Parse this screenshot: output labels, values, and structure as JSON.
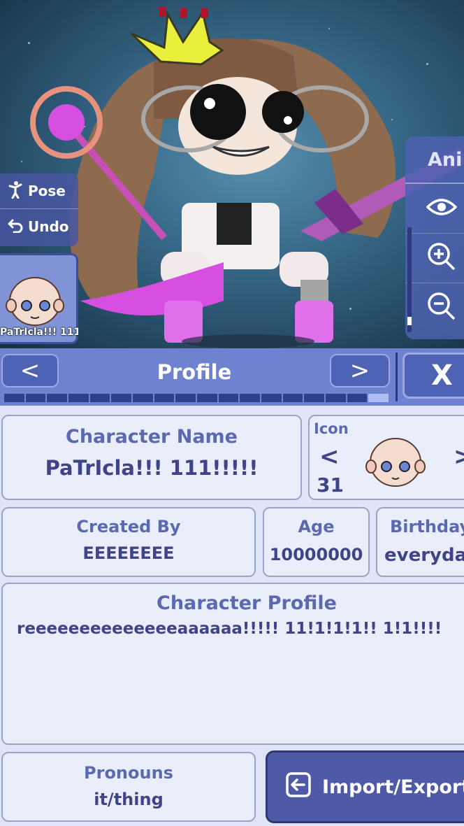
{
  "side_panel": {
    "pose_label": "Pose",
    "undo_label": "Undo"
  },
  "character_slot": {
    "label": "PaTrIcla!!! 111"
  },
  "right_panel": {
    "title": "Ani"
  },
  "header": {
    "title": "Profile",
    "prev": "<",
    "next": ">",
    "close": "X"
  },
  "tab_progress": {
    "filled_fraction": 0.06
  },
  "profile": {
    "name_label": "Character Name",
    "name_value": "PaTrIcla!!! 111!!!!!",
    "icon_label": "Icon",
    "icon_number": "31",
    "icon_prev": "<",
    "icon_next": ">",
    "created_by_label": "Created By",
    "created_by_value": "EEEEEEEE",
    "age_label": "Age",
    "age_value": "10000000",
    "birthday_label": "Birthday",
    "birthday_value": "everyday",
    "profile_label": "Character Profile",
    "profile_value": "reeeeeeeeeeeeeeaaaaaa!!!!! 11!1!1!1!! 1!1!!!!",
    "pronouns_label": "Pronouns",
    "pronouns_value": "it/thing"
  },
  "actions": {
    "import_export_label": "Import/Export"
  },
  "colors": {
    "panel": "#6e82cf",
    "card_bg": "#eaeefa",
    "label": "#5b6ab0",
    "value": "#3f4488",
    "magenta": "#d64fe0"
  }
}
